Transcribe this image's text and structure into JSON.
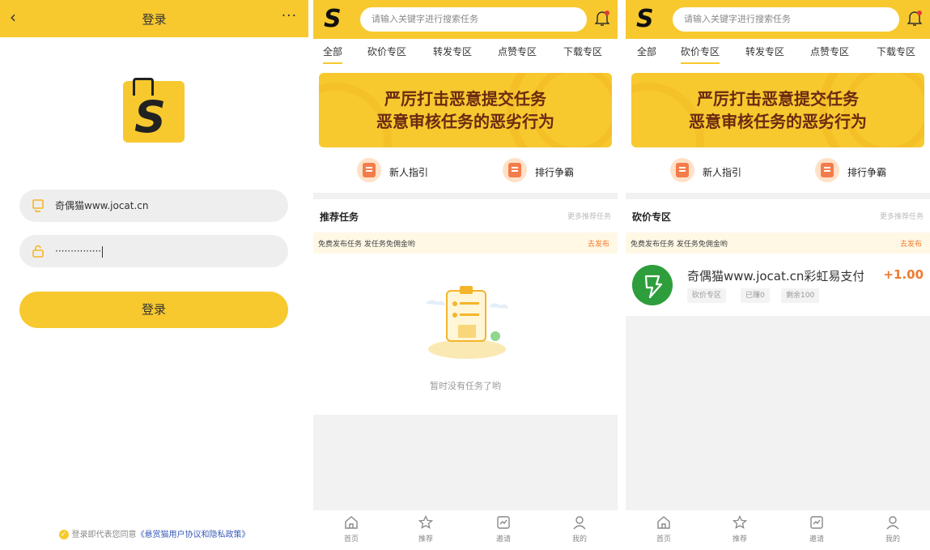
{
  "login": {
    "title": "登录",
    "back_icon": "chevron-left-icon",
    "more_icon": "more-dots-icon",
    "more_label": "···",
    "username_value": "奇偶猫www.jocat.cn",
    "password_value": "···············",
    "login_button": "登录",
    "agree_prefix": "登录即代表您同意",
    "agree_link": "《悬赏猫用户协议和隐私政策》",
    "accent": "#f7c92f"
  },
  "recommend_page": {
    "search_placeholder": "请输入关键字进行搜索任务",
    "tabs": [
      "全部",
      "砍价专区",
      "转发专区",
      "点赞专区",
      "下载专区"
    ],
    "active_tab": 0,
    "banner": {
      "line1": "严厉打击恶意提交任务",
      "line2": "恶意审核任务的恶劣行为"
    },
    "quick": [
      {
        "label": "新人指引",
        "icon": "guide-icon"
      },
      {
        "label": "排行争霸",
        "icon": "ranking-icon"
      }
    ],
    "section_title": "推荐任务",
    "section_more": "更多推荐任务",
    "notice_text": "免费发布任务 发任务免佣金哟",
    "notice_action": "去发布",
    "empty_text": "暂时没有任务了哟"
  },
  "bargain_page": {
    "search_placeholder": "请输入关键字进行搜索任务",
    "tabs": [
      "全部",
      "砍价专区",
      "转发专区",
      "点赞专区",
      "下载专区"
    ],
    "active_tab": 1,
    "banner": {
      "line1": "严厉打击恶意提交任务",
      "line2": "恶意审核任务的恶劣行为"
    },
    "quick": [
      {
        "label": "新人指引",
        "icon": "guide-icon"
      },
      {
        "label": "排行争霸",
        "icon": "ranking-icon"
      }
    ],
    "section_title": "砍价专区",
    "section_more": "更多推荐任务",
    "notice_text": "免费发布任务 发任务免佣金哟",
    "notice_action": "去发布",
    "task": {
      "name": "奇偶猫www.jocat.cn彩虹易支付 - 行",
      "reward": "+1.00",
      "tags": [
        "砍价专区",
        "已赚0",
        "剩余100"
      ]
    }
  },
  "bottom_nav": [
    {
      "label": "首页",
      "icon": "home-icon"
    },
    {
      "label": "推荐",
      "icon": "star-icon"
    },
    {
      "label": "邀请",
      "icon": "invite-icon"
    },
    {
      "label": "我的",
      "icon": "profile-icon"
    }
  ]
}
